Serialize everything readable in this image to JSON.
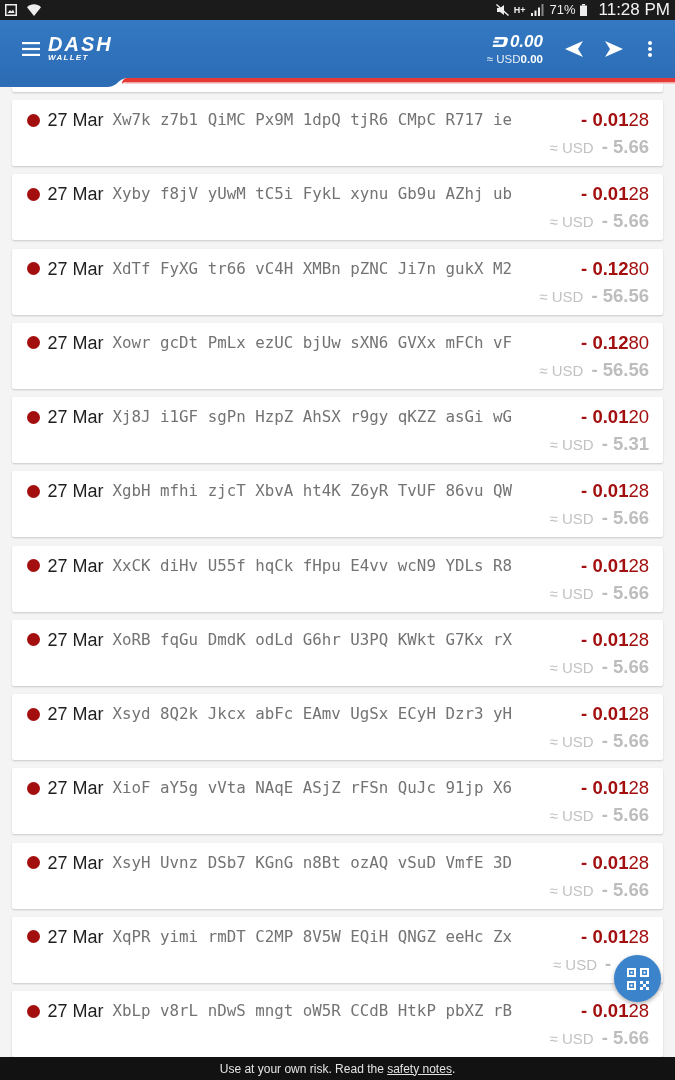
{
  "status_bar": {
    "network_type": "H+",
    "battery": "71%",
    "time": "11:28 PM"
  },
  "app_bar": {
    "logo": {
      "title": "DASH",
      "subtitle": "WALLET"
    },
    "balance": {
      "amount": "0.00",
      "fiat_label": "≈ USD",
      "fiat_amount": "0.00"
    }
  },
  "transactions": [
    {
      "date": "27 Mar",
      "address": "Xw7k z7b1 QiMC Px9M 1dpQ tjR6 CMpC R717 ie",
      "amount": "**- 0.01**28",
      "fiat_label": "≈ USD",
      "fiat_amount": "- 5.66",
      "color": "#a30f0f"
    },
    {
      "date": "27 Mar",
      "address": "Xyby f8jV yUwM tC5i FykL xynu Gb9u AZhj ub",
      "amount": "**- 0.01**28",
      "fiat_label": "≈ USD",
      "fiat_amount": "- 5.66",
      "color": "#a30f0f"
    },
    {
      "date": "27 Mar",
      "address": "XdTf FyXG tr66 vC4H XMBn pZNC Ji7n gukX M2",
      "amount": "**- 0.12**80",
      "fiat_label": "≈ USD",
      "fiat_amount": "- 56.56",
      "color": "#a30f0f"
    },
    {
      "date": "27 Mar",
      "address": "Xowr gcDt PmLx ezUC bjUw sXN6 GVXx mFCh vF",
      "amount": "**- 0.12**80",
      "fiat_label": "≈ USD",
      "fiat_amount": "- 56.56",
      "color": "#a30f0f"
    },
    {
      "date": "27 Mar",
      "address": "Xj8J i1GF sgPn HzpZ AhSX r9gy qKZZ asGi wG",
      "amount": "**- 0.01**20",
      "fiat_label": "≈ USD",
      "fiat_amount": "- 5.31",
      "color": "#a30f0f"
    },
    {
      "date": "27 Mar",
      "address": "XgbH mfhi zjcT XbvA ht4K Z6yR TvUF 86vu QW",
      "amount": "**- 0.01**28",
      "fiat_label": "≈ USD",
      "fiat_amount": "- 5.66",
      "color": "#a30f0f"
    },
    {
      "date": "27 Mar",
      "address": "XxCK diHv U55f hqCk fHpu E4vv wcN9 YDLs R8",
      "amount": "**- 0.01**28",
      "fiat_label": "≈ USD",
      "fiat_amount": "- 5.66",
      "color": "#a30f0f"
    },
    {
      "date": "27 Mar",
      "address": "XoRB fqGu DmdK odLd G6hr U3PQ KWkt G7Kx rX",
      "amount": "**- 0.01**28",
      "fiat_label": "≈ USD",
      "fiat_amount": "- 5.66",
      "color": "#a30f0f"
    },
    {
      "date": "27 Mar",
      "address": "Xsyd 8Q2k Jkcx abFc EAmv UgSx ECyH Dzr3 yH",
      "amount": "**- 0.01**28",
      "fiat_label": "≈ USD",
      "fiat_amount": "- 5.66",
      "color": "#a30f0f"
    },
    {
      "date": "27 Mar",
      "address": "XioF aY5g vVta NAqE ASjZ rFSn QuJc 91jp X6",
      "amount": "**- 0.01**28",
      "fiat_label": "≈ USD",
      "fiat_amount": "- 5.66",
      "color": "#a30f0f"
    },
    {
      "date": "27 Mar",
      "address": "XsyH Uvnz DSb7 KGnG n8Bt ozAQ vSuD VmfE 3D",
      "amount": "**- 0.01**28",
      "fiat_label": "≈ USD",
      "fiat_amount": "- 5.66",
      "color": "#a30f0f"
    },
    {
      "date": "27 Mar",
      "address": "XqPR yimi rmDT C2MP 8V5W EQiH QNGZ eeHc Zx",
      "amount": "**- 0.01**28",
      "fiat_label": "≈ USD",
      "fiat_amount": "-",
      "color": "#a30f0f"
    },
    {
      "date": "27 Mar",
      "address": "XbLp v8rL nDwS mngt oW5R CCdB HtkP pbXZ rB",
      "amount": "**- 0.01**28",
      "fiat_label": "≈ USD",
      "fiat_amount": "- 5.66",
      "color": "#a30f0f"
    }
  ],
  "footer": {
    "text": "Use at your own risk. Read the ",
    "link": "safety notes",
    "after": "."
  }
}
